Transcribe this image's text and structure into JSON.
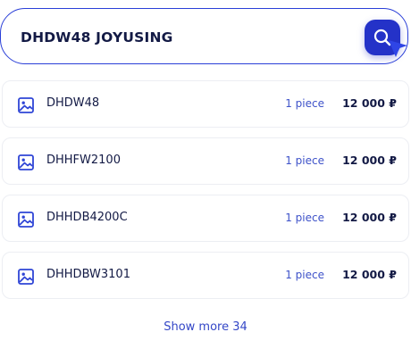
{
  "search": {
    "value": "DHDW48 JOYUSING",
    "button_icon": "search-icon"
  },
  "colors": {
    "accent": "#2432C8",
    "link": "#3447C7",
    "text": "#131A45",
    "border": "#ECEEF3"
  },
  "results": [
    {
      "name": "DHDW48",
      "quantity": "1 piece",
      "price": "12 000 ₽",
      "icon": "image-icon"
    },
    {
      "name": "DHHFW2100",
      "quantity": "1 piece",
      "price": "12 000 ₽",
      "icon": "image-icon"
    },
    {
      "name": "DHHDB4200C",
      "quantity": "1 piece",
      "price": "12 000 ₽",
      "icon": "image-icon"
    },
    {
      "name": "DHHDBW3101",
      "quantity": "1 piece",
      "price": "12 000 ₽",
      "icon": "image-icon"
    }
  ],
  "show_more": {
    "label": "Show more 34"
  }
}
